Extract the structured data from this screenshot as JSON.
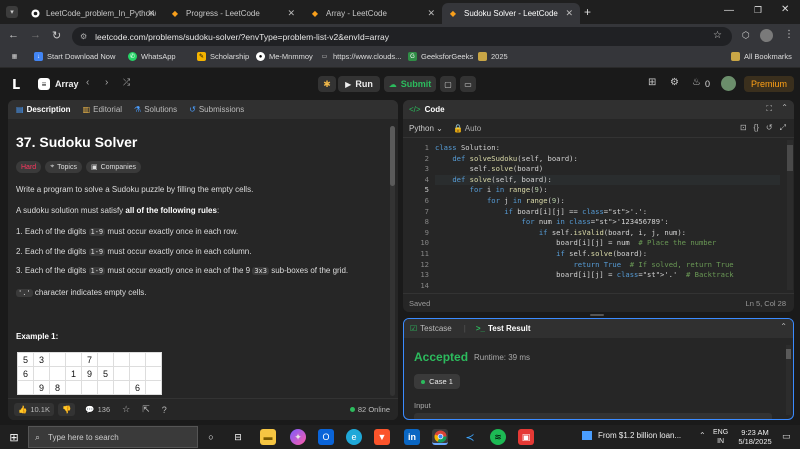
{
  "browser": {
    "tabs": [
      {
        "title": "LeetCode_problem_In_Python/",
        "active": false
      },
      {
        "title": "Progress - LeetCode",
        "active": false
      },
      {
        "title": "Array - LeetCode",
        "active": false
      },
      {
        "title": "Sudoku Solver - LeetCode",
        "active": true
      }
    ],
    "url": "leetcode.com/problems/sudoku-solver/?envType=problem-list-v2&envId=array",
    "bookmarks": [
      "Start Download Now",
      "WhatsApp",
      "Scholarship",
      "Me-Mnmmoy",
      "https://www.clouds...",
      "GeeksforGeeks",
      "2025"
    ],
    "all_bookmarks": "All Bookmarks"
  },
  "lc_header": {
    "list_name": "Array",
    "run": "Run",
    "submit": "Submit",
    "fire_count": "0",
    "premium": "Premium"
  },
  "left_panel": {
    "tabs": [
      "Description",
      "Editorial",
      "Solutions",
      "Submissions"
    ],
    "title": "37. Sudoku Solver",
    "difficulty": "Hard",
    "topics": "Topics",
    "companies": "Companies",
    "intro": "Write a program to solve a Sudoku puzzle by filling the empty cells.",
    "rules_lead": "A sudoku solution must satisfy ",
    "rules_bold": "all of the following rules",
    "rules_tail": ":",
    "rules": [
      {
        "pre": "Each of the digits ",
        "code": "1-9",
        "post": " must occur exactly once in each row."
      },
      {
        "pre": "Each of the digits ",
        "code": "1-9",
        "post": " must occur exactly once in each column."
      },
      {
        "pre": "Each of the digits ",
        "code": "1-9",
        "post": " must occur exactly once in each of the 9 ",
        "code2": "3x3",
        "post2": " sub-boxes of the grid."
      }
    ],
    "dot_code": "'.'",
    "dot_text": " character indicates empty cells.",
    "example": "Example 1:",
    "grid_rows": [
      [
        "5",
        "3",
        "",
        "",
        "7",
        "",
        "",
        "",
        ""
      ],
      [
        "6",
        "",
        "",
        "1",
        "9",
        "5",
        "",
        "",
        ""
      ],
      [
        "",
        "9",
        "8",
        "",
        "",
        "",
        "",
        "6",
        ""
      ]
    ],
    "likes": "10.1K",
    "comments": "136",
    "online": "82 Online"
  },
  "code_panel": {
    "title": "Code",
    "language": "Python",
    "auto": "Auto",
    "status": "Saved",
    "cursor": "Ln 5, Col 28",
    "lines": [
      "class Solution:",
      "    def solveSudoku(self, board):",
      "        self.solve(board)",
      "",
      "    def solve(self, board):",
      "        for i in range(9):",
      "            for j in range(9):",
      "                if board[i][j] == '.':",
      "                    for num in '123456789':",
      "                        if self.isValid(board, i, j, num):",
      "                            board[i][j] = num  # Place the number",
      "                            if self.solve(board):",
      "                                return True  # If solved, return True",
      "                            board[i][j] = '.'  # Backtrack"
    ]
  },
  "result_panel": {
    "testcase_tab": "Testcase",
    "result_tab": "Test Result",
    "status": "Accepted",
    "runtime": "Runtime: 39 ms",
    "case": "Case 1",
    "input_label": "Input"
  },
  "taskbar": {
    "search": "Type here to search",
    "news": "From $1.2 billion loan...",
    "lang1": "ENG",
    "lang2": "IN",
    "time": "9:23 AM",
    "date": "5/18/2025"
  }
}
